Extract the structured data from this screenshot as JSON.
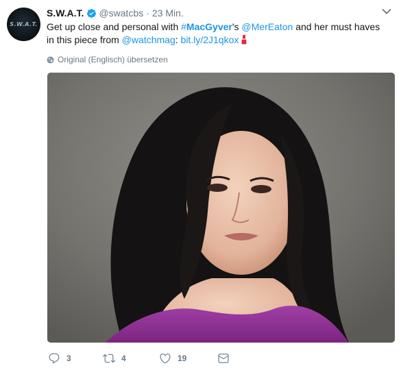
{
  "tweet": {
    "avatar_text": "S.W.A.T.",
    "display_name": "S.W.A.T.",
    "verified": true,
    "handle": "@swatcbs",
    "separator": "·",
    "time": "23 Min.",
    "text": {
      "part1": "Get up close and personal with ",
      "hashtag_symbol": "#",
      "hashtag_word": "MacGyver",
      "part2": "'s ",
      "mention1": "@MerEaton",
      "part3": " and her must haves in this piece from ",
      "mention2": "@watchmag",
      "part4": ": ",
      "link": "bit.ly/2J1qkox"
    },
    "translate_label": "Original (Englisch) übersetzen",
    "actions": {
      "replies": "3",
      "retweets": "4",
      "likes": "19"
    }
  },
  "icons": {
    "verified": "verified-badge-icon",
    "caret": "chevron-down-icon",
    "lipstick": "lipstick-emoji-icon",
    "globe": "globe-icon",
    "reply": "reply-icon",
    "retweet": "retweet-icon",
    "like": "heart-icon",
    "dm": "envelope-icon"
  },
  "colors": {
    "link": "#1b95e0",
    "verified": "#1da1f2",
    "muted": "#657786",
    "text": "#14171a"
  }
}
